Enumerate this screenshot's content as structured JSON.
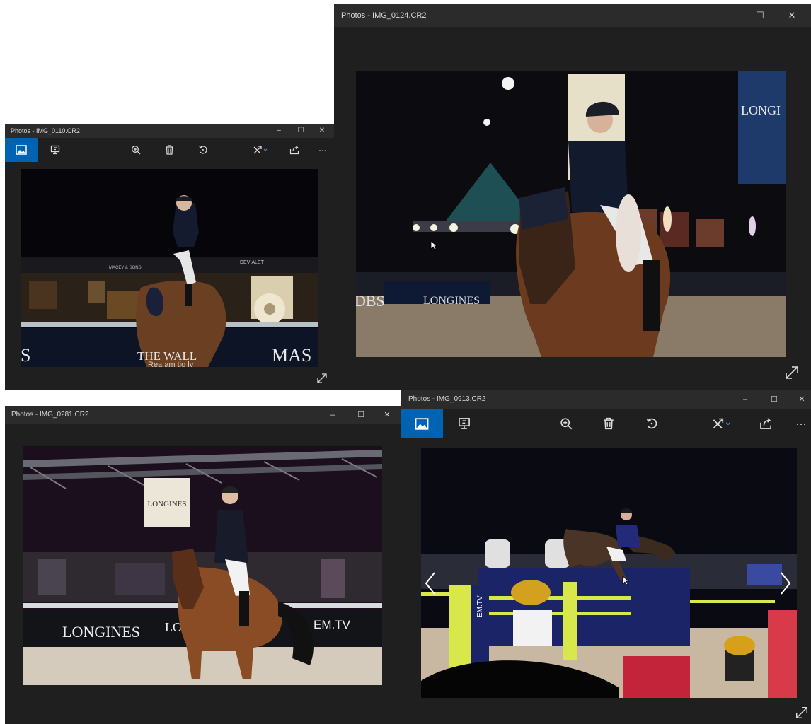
{
  "windows": {
    "w1": {
      "title": "Photos - IMG_0110.CR2",
      "controls": {
        "minimize": "–",
        "maximize": "☐",
        "close": "✕"
      },
      "photo_text": {
        "left_banner": "THE WALL",
        "right_banner": "MAS",
        "left_letter": "S",
        "sponsor_top": "MACEY & SONS",
        "sponsor_right": "DEVIALET",
        "bottom_script": "Rea  am  tio  ly"
      }
    },
    "w2": {
      "title": "Photos - IMG_0124.CR2",
      "controls": {
        "minimize": "–",
        "maximize": "☐",
        "close": "✕"
      },
      "photo_text": {
        "right_banner": "LONGI",
        "board_left": "DBS",
        "board_center": "LONGINES"
      }
    },
    "w3": {
      "title": "Photos - IMG_0281.CR2",
      "controls": {
        "minimize": "–",
        "maximize": "☐",
        "close": "✕"
      },
      "photo_text": {
        "hanging_sign": "LONGINES",
        "board_left": "LONGINES",
        "board_mid": "LO",
        "board_right": "EM.TV"
      }
    },
    "w4": {
      "title": "Photos - IMG_0913.CR2",
      "controls": {
        "minimize": "–",
        "maximize": "☐",
        "close": "✕",
        "more": "···"
      },
      "photo_text": {
        "fence_label": "EM.TV"
      }
    }
  },
  "colors": {
    "titlebar": "#2b2b2b",
    "window_bg": "#1f1f1f",
    "accent": "#0063b1",
    "arena_sand": "#c9c0b3"
  },
  "icons": [
    "view-photo-icon",
    "slideshow-icon",
    "zoom-in-icon",
    "delete-icon",
    "rotate-icon",
    "edit-icon",
    "share-icon",
    "more-icon",
    "expand-icon",
    "prev-arrow-icon",
    "next-arrow-icon"
  ]
}
